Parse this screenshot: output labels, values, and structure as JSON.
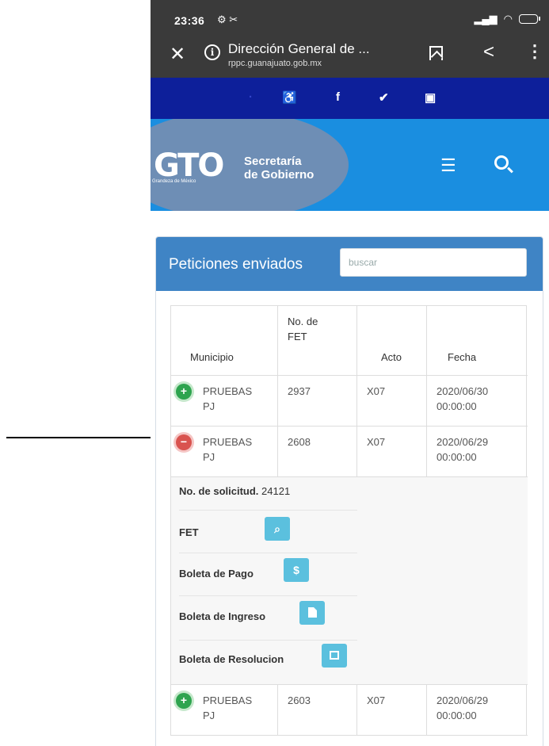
{
  "status_bar": {
    "time": "23:36",
    "left_icons": "⚙ ✂",
    "right_icons": "📶 ✉"
  },
  "browser": {
    "title": "Dirección General de ...",
    "url": "rppc.guanajuato.gob.mx"
  },
  "social_icons": [
    "accessibility-icon",
    "facebook-icon",
    "twitter-icon",
    "youtube-icon"
  ],
  "brand": {
    "logo_text": "GTO",
    "logo_tagline": "Grandeza de México",
    "secretaria_line1": "Secretaría",
    "secretaria_line2": "de Gobierno"
  },
  "panel": {
    "title": "Peticiones enviados",
    "search_placeholder": "buscar",
    "headers": {
      "municipio": "Municipio",
      "no_fet": "No. de FET",
      "acto": "Acto",
      "fecha": "Fecha"
    },
    "rows": [
      {
        "municipio": "PRUEBAS PJ",
        "no_fet": "2937",
        "acto": "X07",
        "fecha": "2020/06/30 00:00:00",
        "toggle": "+"
      },
      {
        "municipio": "PRUEBAS PJ",
        "no_fet": "2608",
        "acto": "X07",
        "fecha": "2020/06/29 00:00:00",
        "toggle": "−"
      },
      {
        "municipio": "PRUEBAS PJ",
        "no_fet": "2603",
        "acto": "X07",
        "fecha": "2020/06/29 00:00:00",
        "toggle": "+"
      }
    ],
    "detail": {
      "solicitud_label": "No. de solicitud.",
      "solicitud_value": "24121",
      "fet_label": "FET",
      "boleta_pago_label": "Boleta de Pago",
      "boleta_pago_symbol": "$",
      "boleta_ingreso_label": "Boleta de Ingreso",
      "boleta_resolucion_label": "Boleta de Resolucion"
    }
  },
  "colors": {
    "chrome": "#3a3a3a",
    "social_bar": "#0d1f9a",
    "brand_bar": "#1a8ee0",
    "panel_header": "#3f84c5",
    "action_button": "#5bc0de",
    "expand_green": "#2ea44f",
    "collapse_red": "#d9534f"
  }
}
